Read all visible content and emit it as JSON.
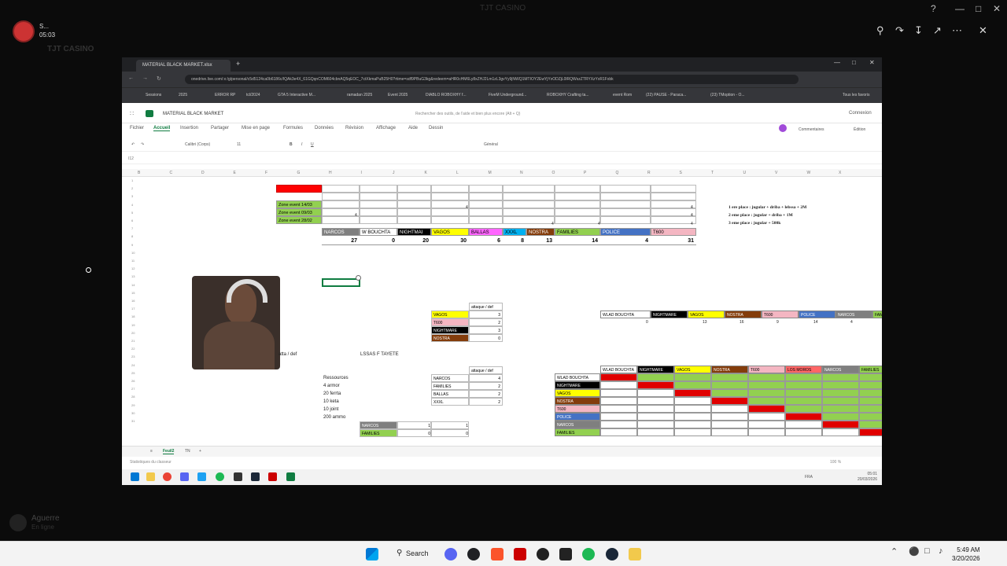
{
  "viewer": {
    "title": "TJT CASINO",
    "user_initial": "S...",
    "elapsed": "05:03",
    "channel": "TJT CASINO",
    "notice": "Mirrored share in progress",
    "notice_btn": "...",
    "bottom_user": "Aguerre",
    "bottom_status": "En ligne"
  },
  "browser": {
    "tab_title": "MATERIAL BLACK MARKET.xlsx",
    "url": "onedrive.live.com/:x:/g/personal/c5d5124ca0b6186c/IQAk3e4X_61GQqnCOM604cbnAQ5qEOC_7ctXkmaPuB25H0?rtime=sdf9PBuG3kg&redeem=aHR0cHM6Ly8xZHJ2Lm1zL3gvYy9jNWQ1MTIOY2EwYjYxODZjL0lRQWszZTRYXzYxR1Fxbk",
    "bookmarks": [
      "Sessions",
      "2025",
      "ERROR RP",
      "tcl/2024",
      "GTA 5 Interactive M...",
      "ramadan 2025",
      "Event 2025",
      "DIABLO ROBOXHY f...",
      "FiveM Underground...",
      "ROBOXHY Crafting ta...",
      "event Rom",
      "(22) PAUSE - Paraca...",
      "(23) TMoption - O...",
      "Tous les favoris"
    ]
  },
  "excel": {
    "doc_name": "MATERIAL BLACK MARKET",
    "search_placeholder": "Rechercher des outils, de l'aide et bien plus encore (Alt + Q)",
    "connect": "Connexion",
    "tabs": [
      "Fichier",
      "Accueil",
      "Insertion",
      "Partager",
      "Mise en page",
      "Formules",
      "Données",
      "Révision",
      "Affichage",
      "Aide",
      "Dessin"
    ],
    "comments": "Commentaires",
    "edit": "Édition",
    "font_name": "Calibri (Corps)",
    "font_size": "11",
    "number_format": "Général",
    "cell_ref": "I12",
    "columns": [
      "B",
      "C",
      "D",
      "E",
      "F",
      "G",
      "H",
      "I",
      "J",
      "K",
      "L",
      "M",
      "N",
      "O",
      "P",
      "Q",
      "R",
      "S",
      "T",
      "U",
      "V",
      "W",
      "X"
    ],
    "rows": [
      "1",
      "2",
      "3",
      "4",
      "5",
      "6",
      "7",
      "8",
      "9",
      "10",
      "11",
      "12",
      "13",
      "14",
      "15",
      "16",
      "17",
      "18",
      "19",
      "20",
      "21",
      "22",
      "23",
      "24",
      "25",
      "26",
      "27",
      "28",
      "29",
      "30",
      "31"
    ],
    "zones": [
      "Zone event 14/03",
      "Zone event 09/03",
      "Zone event 28/02"
    ],
    "zone_vals": [
      "4",
      "4",
      "4",
      "4",
      "4",
      "4",
      "4"
    ],
    "gangs": [
      {
        "name": "NARCOS",
        "score": "27",
        "color": "#7f7f7f"
      },
      {
        "name": "W BOUCHTA",
        "score": "0",
        "color": "#ffffff"
      },
      {
        "name": "NIGHTMAI",
        "score": "20",
        "color": "#000000"
      },
      {
        "name": "VAGOS",
        "score": "30",
        "color": "#ffff00"
      },
      {
        "name": "BALLAS",
        "score": "6",
        "color": "#ff66ff"
      },
      {
        "name": "XXXL",
        "score": "8",
        "color": "#00b0f0"
      },
      {
        "name": "NOSTRA",
        "score": "13",
        "color": "#833c0b"
      },
      {
        "name": "FAMILIES",
        "score": "14",
        "color": "#92d050"
      },
      {
        "name": "POLICE",
        "score": "4",
        "color": "#4472c4"
      },
      {
        "name": "T600",
        "score": "31",
        "color": "#f4b6c2"
      }
    ],
    "prizes": [
      "1 ere place : jugular + driba + lebssa + 2M",
      "2 eme place : jugular + driba + 1M",
      "3 eme place : jugular + 500k"
    ],
    "attaque_header": "attaque / def",
    "attaque1": [
      {
        "name": "VAGOS",
        "val": "3",
        "color": "#ffff00"
      },
      {
        "name": "T600",
        "val": "2",
        "color": "#f4b6c2"
      },
      {
        "name": "NIGHTMARE",
        "val": "3",
        "color": "#000000"
      },
      {
        "name": "NOSTRA",
        "val": "0",
        "color": "#833c0b"
      }
    ],
    "attaque2": [
      {
        "name": "NARCOS",
        "val": "4"
      },
      {
        "name": "FAMILIES",
        "val": "2"
      },
      {
        "name": "BALLAS",
        "val": "2"
      },
      {
        "name": "XXXL",
        "val": "2"
      }
    ],
    "ressources_title": "Ressources",
    "ressources": [
      "4 armor",
      "20 ferrta",
      "10 keta",
      "10 joint",
      "200 ammo"
    ],
    "att_def_label": "atta / def",
    "lssa_label": "LSSAS F TAYETE",
    "small_pair": [
      {
        "name": "NARCOS",
        "a": "1",
        "b": "1",
        "color": "#7f7f7f"
      },
      {
        "name": "FAMILIES",
        "a": "0",
        "b": "0",
        "color": "#92d050"
      }
    ],
    "ranking_header": [
      {
        "name": "WLAD BOUCHTA",
        "color": "#ffffff"
      },
      {
        "name": "NIGHTMARE",
        "color": "#000000"
      },
      {
        "name": "VAGOS",
        "color": "#ffff00"
      },
      {
        "name": "NOSTRA",
        "color": "#833c0b"
      },
      {
        "name": "T600",
        "color": "#f4b6c2"
      },
      {
        "name": "POLICE",
        "color": "#4472c4"
      },
      {
        "name": "NARCOS",
        "color": "#7f7f7f"
      },
      {
        "name": "FAMILIES",
        "color": "#92d050"
      }
    ],
    "ranking_vals": [
      "0",
      "13",
      "16",
      "9",
      "14",
      "4",
      "15"
    ],
    "matrix_header": [
      {
        "name": "WLAD BOUCHTA",
        "color": "#ffffff"
      },
      {
        "name": "NIGHTMARE",
        "color": "#000000"
      },
      {
        "name": "VAGOS",
        "color": "#ffff00"
      },
      {
        "name": "NOSTRA",
        "color": "#833c0b"
      },
      {
        "name": "T600",
        "color": "#f4b6c2"
      },
      {
        "name": "LOS MOROS",
        "color": "#ff6666"
      },
      {
        "name": "NARCOS",
        "color": "#7f7f7f"
      },
      {
        "name": "FAMILIES",
        "color": "#92d050"
      }
    ],
    "matrix_rows": [
      {
        "name": "WLAD BOUCHTA",
        "color": "#ffffff"
      },
      {
        "name": "NIGHTMARE",
        "color": "#000000"
      },
      {
        "name": "VAGOS",
        "color": "#ffff00"
      },
      {
        "name": "NOSTRA",
        "color": "#833c0b"
      },
      {
        "name": "T600",
        "color": "#f4b6c2"
      },
      {
        "name": "POLICE",
        "color": "#4472c4"
      },
      {
        "name": "NARCOS",
        "color": "#7f7f7f"
      },
      {
        "name": "FAMILIES",
        "color": "#92d050"
      }
    ],
    "sheets": [
      "Feuil2",
      "TN"
    ],
    "status_left": "Statistiques du classeur",
    "zoom": "100 %"
  },
  "taskbar": {
    "search": "Search",
    "time": "5:49 AM",
    "date": "3/20/2026",
    "inner_time": "05:01",
    "inner_date": "20/03/2026",
    "lang": "FRA"
  }
}
